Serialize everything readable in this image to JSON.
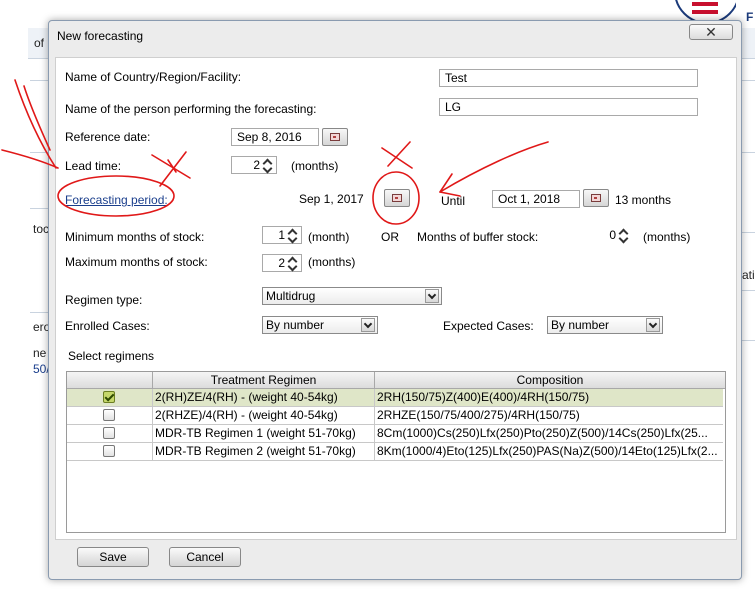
{
  "background": {
    "fragments": [
      "of",
      "toc",
      "ero",
      "ne",
      "50/",
      "ati",
      "F"
    ]
  },
  "dialog": {
    "title": "New forecasting",
    "close_label": "✕"
  },
  "form": {
    "country_label": "Name of Country/Region/Facility:",
    "country_value": "Test",
    "person_label": "Name of the person performing the forecasting:",
    "person_value": "LG",
    "reference_label": "Reference date:",
    "reference_value": "Sep 8, 2016",
    "lead_label": "Lead time:",
    "lead_value": "2",
    "lead_unit": "(months)",
    "period_label": "Forecasting period:",
    "period_start": "Sep 1, 2017",
    "until_label": "Until",
    "period_end": "Oct 1, 2018",
    "period_months": "13 months",
    "min_label": "Minimum months of stock:",
    "min_value": "1",
    "min_unit": "(month)",
    "or_label": "OR",
    "buffer_label": "Months of buffer stock:",
    "buffer_value": "0",
    "buffer_unit": "(months)",
    "max_label": "Maximum months of stock:",
    "max_value": "2",
    "max_unit": "(months)",
    "regimen_type_label": "Regimen type:",
    "regimen_type_value": "Multidrug",
    "enrolled_label": "Enrolled Cases:",
    "enrolled_value": "By number",
    "expected_label": "Expected Cases:",
    "expected_value": "By number"
  },
  "regimens": {
    "title": "Select regimens",
    "columns": [
      "Treatment Regimen",
      "Composition"
    ],
    "rows": [
      {
        "checked": true,
        "regimen": "2(RH)ZE/4(RH) - (weight 40-54kg)",
        "composition": "2RH(150/75)Z(400)E(400)/4RH(150/75)"
      },
      {
        "checked": false,
        "regimen": "2(RHZE)/4(RH) - (weight 40-54kg)",
        "composition": "2RHZE(150/75/400/275)/4RH(150/75)"
      },
      {
        "checked": false,
        "regimen": "MDR-TB Regimen 1 (weight 51-70kg)",
        "composition": "8Cm(1000)Cs(250)Lfx(250)Pto(250)Z(500)/14Cs(250)Lfx(25..."
      },
      {
        "checked": false,
        "regimen": "MDR-TB Regimen 2 (weight 51-70kg)",
        "composition": "8Km(1000/4)Eto(125)Lfx(250)PAS(Na)Z(500)/14Eto(125)Lfx(2..."
      }
    ]
  },
  "buttons": {
    "save": "Save",
    "cancel": "Cancel"
  },
  "colors": {
    "annotation": "#e01818",
    "selected_row": "#dfe6c8",
    "link": "#1a3e8c"
  }
}
